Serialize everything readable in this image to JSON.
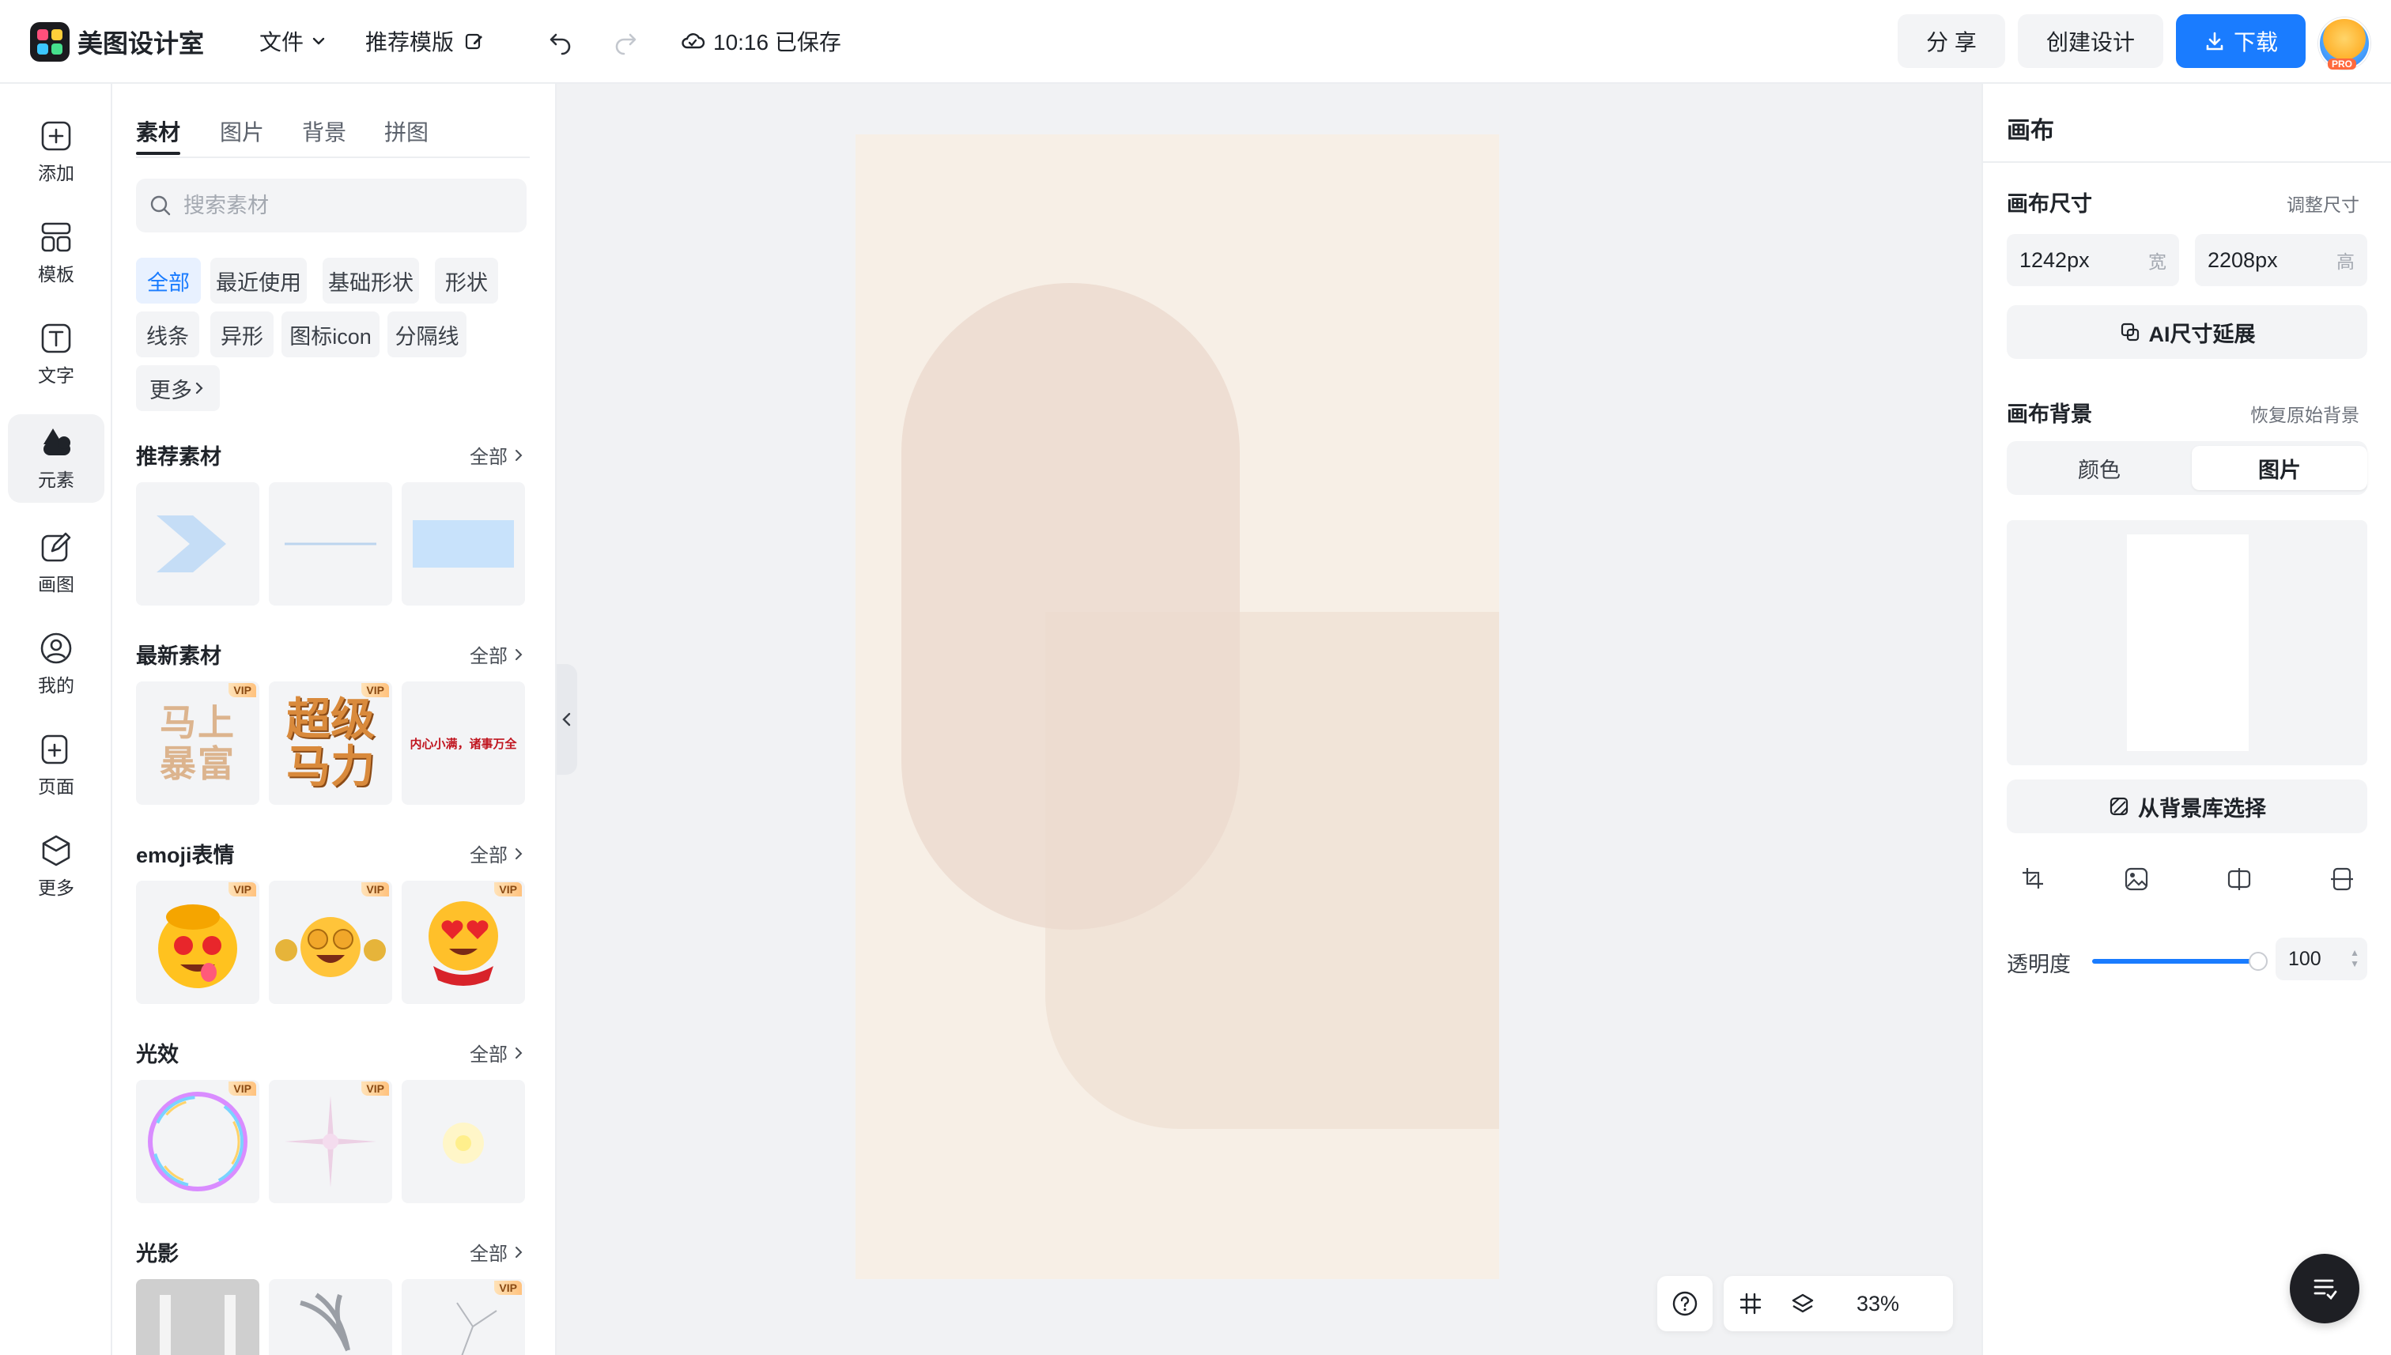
{
  "header": {
    "app_name": "美图设计室",
    "menu_file": "文件",
    "menu_recommend": "推荐模版",
    "save_status": "10:16 已保存",
    "share_label": "分 享",
    "create_label": "创建设计",
    "download_label": "下载",
    "avatar_badge": "PRO"
  },
  "rail": {
    "items": [
      {
        "label": "添加",
        "icon": "plus-square-icon"
      },
      {
        "label": "模板",
        "icon": "template-icon"
      },
      {
        "label": "文字",
        "icon": "text-icon"
      },
      {
        "label": "元素",
        "icon": "shapes-icon",
        "active": true
      },
      {
        "label": "画图",
        "icon": "pen-icon"
      },
      {
        "label": "我的",
        "icon": "user-icon"
      },
      {
        "label": "页面",
        "icon": "add-page-icon"
      },
      {
        "label": "更多",
        "icon": "box-icon"
      }
    ]
  },
  "panel": {
    "tabs": [
      "素材",
      "图片",
      "背景",
      "拼图"
    ],
    "active_tab": "素材",
    "search_placeholder": "搜索素材",
    "chips": [
      "全部",
      "最近使用",
      "基础形状",
      "形状",
      "线条",
      "异形",
      "图标icon",
      "分隔线",
      "更多"
    ],
    "active_chip": "全部",
    "all_label": "全部",
    "vip_label": "VIP",
    "sections": [
      {
        "title": "推荐素材"
      },
      {
        "title": "最新素材",
        "texts": [
          "马上暴富",
          "超级马力",
          "内心小满，诸事万全"
        ]
      },
      {
        "title": "emoji表情"
      },
      {
        "title": "光效"
      },
      {
        "title": "光影"
      }
    ]
  },
  "canvas": {
    "zoom": "33%",
    "background": "#f7efe6"
  },
  "right_panel": {
    "title": "画布",
    "size_label": "画布尺寸",
    "resize_link": "调整尺寸",
    "width_value": "1242px",
    "width_unit": "宽",
    "height_value": "2208px",
    "height_unit": "高",
    "ai_extend": "AI尺寸延展",
    "bg_label": "画布背景",
    "restore_link": "恢复原始背景",
    "seg_color": "颜色",
    "seg_image": "图片",
    "seg_active": "图片",
    "choose_bg": "从背景库选择",
    "opacity_label": "透明度",
    "opacity_value": "100",
    "opacity": 1.0
  },
  "colors": {
    "accent": "#1a7cff",
    "canvas_bg": "#f7efe6",
    "shape": "#ecdbcf"
  }
}
